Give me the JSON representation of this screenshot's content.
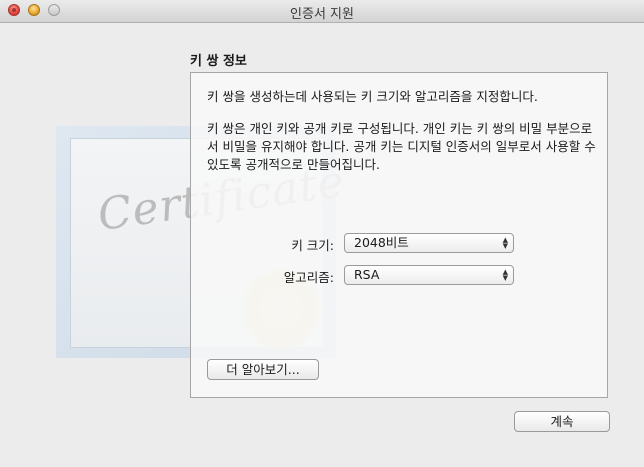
{
  "window": {
    "title": "인증서 지원"
  },
  "section": {
    "heading": "키 쌍 정보",
    "intro": "키 쌍을 생성하는데 사용되는 키 크기와 알고리즘을 지정합니다.",
    "description_lines": [
      "키 쌍은 개인 키와 공개 키로 구성됩니다. 개인 키는 키 쌍의 비밀 부분으로",
      "서 비밀을 유지해야 합니다. 공개 키는 디지털 인증서의 일부로서 사용할 수",
      "있도록 공개적으로 만들어집니다."
    ]
  },
  "artwork": {
    "word": "Certificate"
  },
  "form": {
    "key_size": {
      "label": "키 크기:",
      "value": "2048비트"
    },
    "algorithm": {
      "label": "알고리즘:",
      "value": "RSA"
    }
  },
  "buttons": {
    "learn_more": "더 알아보기...",
    "continue": "계속"
  },
  "icons": {
    "popup_arrows": "up-down-chevron-icon",
    "lights": [
      "close",
      "minimize",
      "zoom"
    ]
  }
}
